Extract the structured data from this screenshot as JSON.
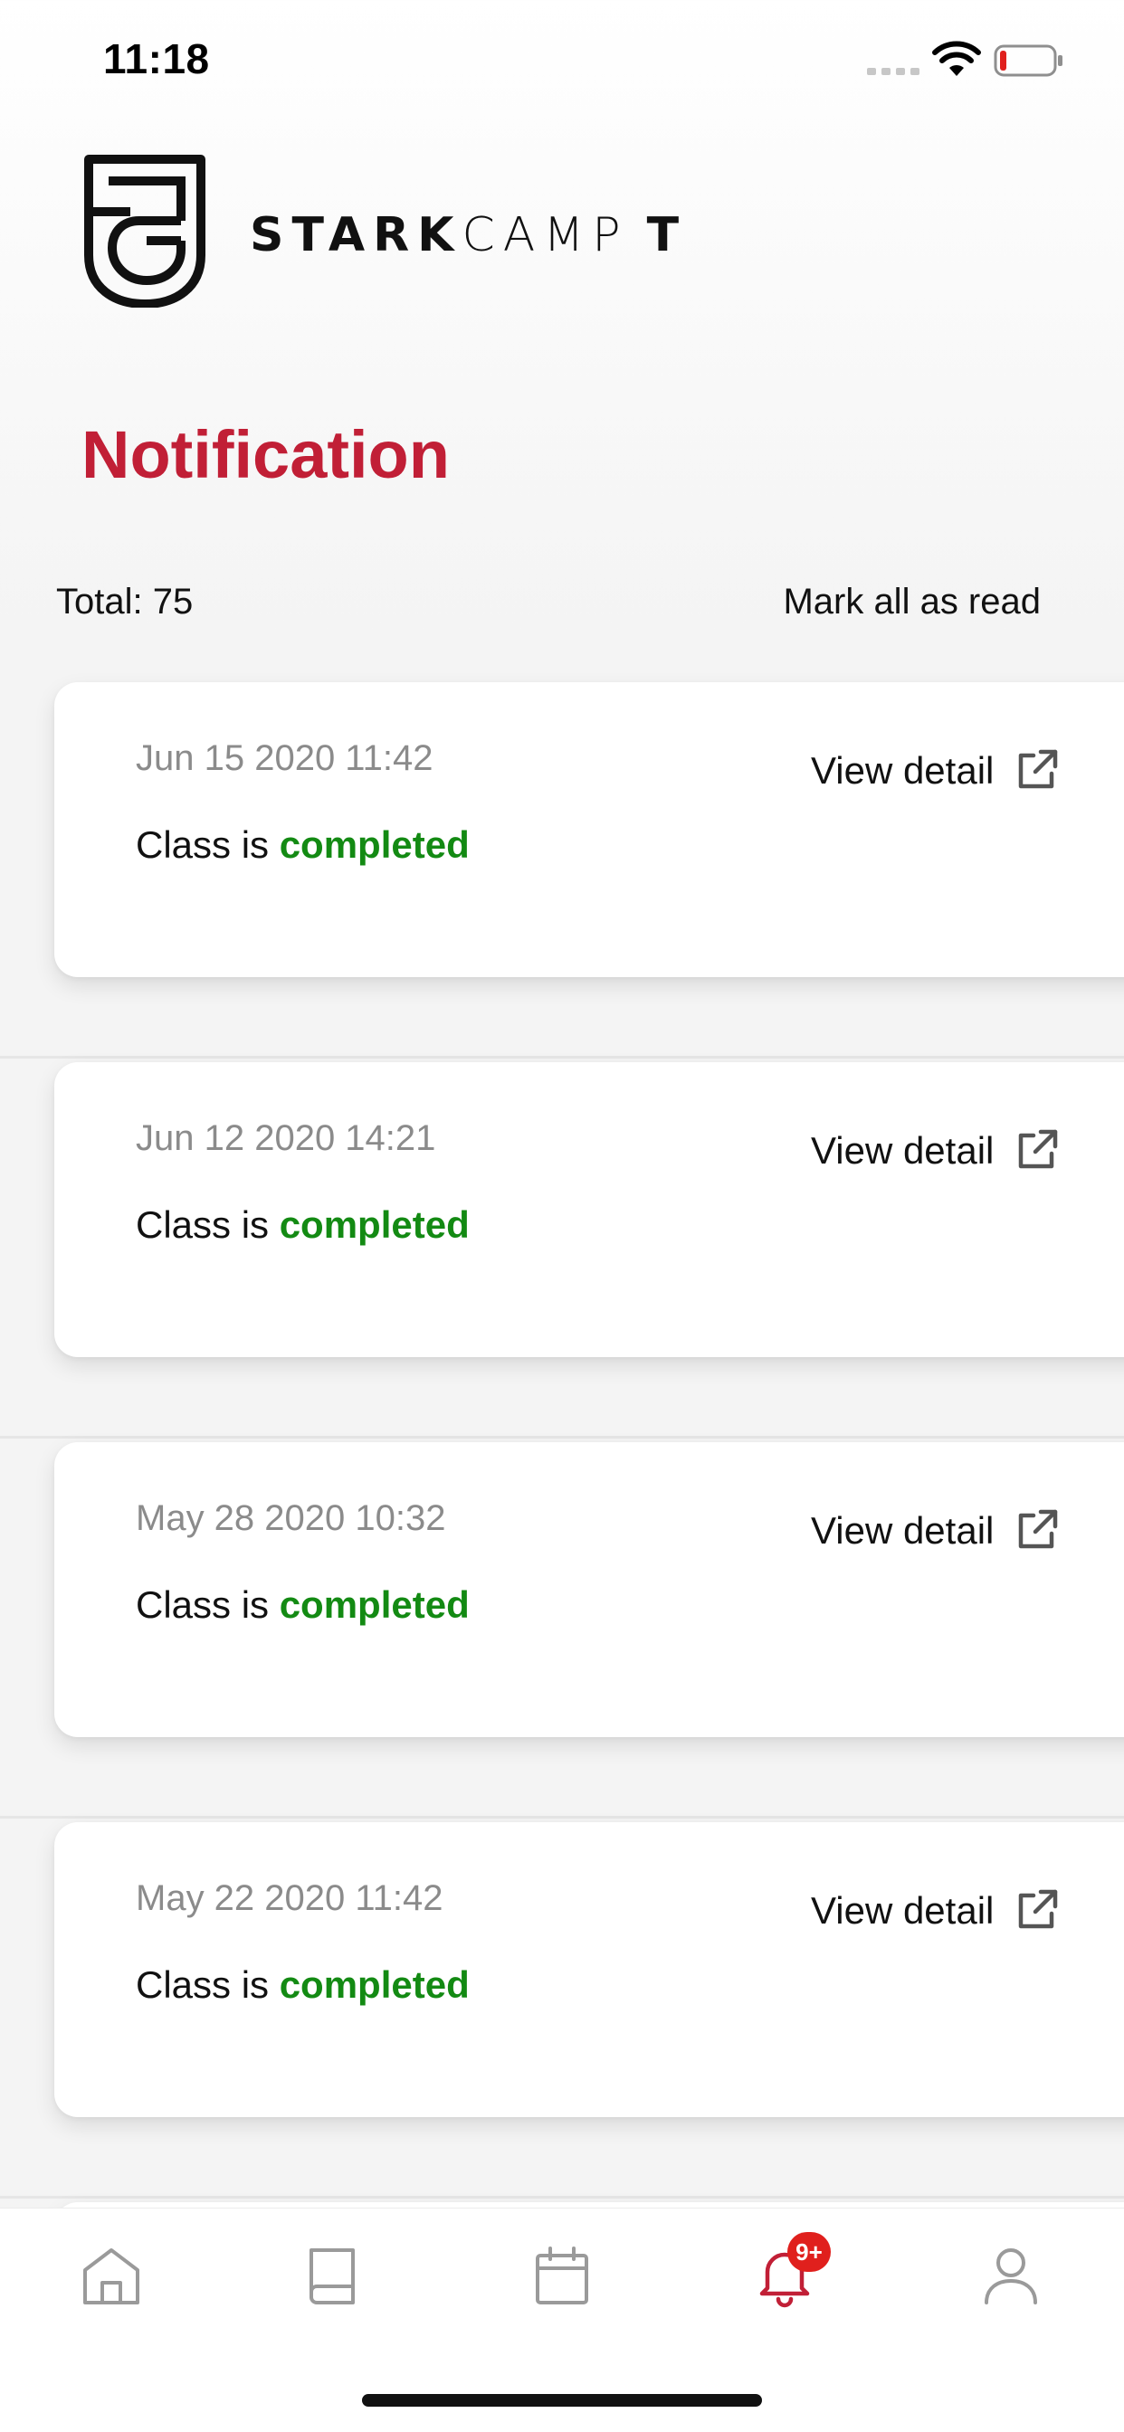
{
  "status_bar": {
    "time": "11:18",
    "icons": [
      "signal-icon",
      "wifi-icon",
      "battery-icon"
    ]
  },
  "brand": {
    "logo_icon": "shield-logo-icon",
    "name_bold": "STARK",
    "name_light": "CAMP",
    "name_suffix": "T"
  },
  "page": {
    "title": "Notification",
    "total_label": "Total: 75",
    "mark_all_label": "Mark all as read"
  },
  "notifications": [
    {
      "date": "Jun 15 2020 11:42",
      "message_prefix": "Class is ",
      "status": "completed",
      "action": "View detail"
    },
    {
      "date": "Jun 12 2020 14:21",
      "message_prefix": "Class is ",
      "status": "completed",
      "action": "View detail"
    },
    {
      "date": "May 28 2020 10:32",
      "message_prefix": "Class is ",
      "status": "completed",
      "action": "View detail"
    },
    {
      "date": "May 22 2020 11:42",
      "message_prefix": "Class is ",
      "status": "completed",
      "action": "View detail"
    }
  ],
  "tab_bar": {
    "tabs": [
      {
        "name": "home",
        "icon": "home-icon",
        "active": false
      },
      {
        "name": "book",
        "icon": "book-icon",
        "active": false
      },
      {
        "name": "calendar",
        "icon": "calendar-icon",
        "active": false
      },
      {
        "name": "notifications",
        "icon": "bell-icon",
        "active": true
      },
      {
        "name": "profile",
        "icon": "user-icon",
        "active": false
      }
    ],
    "notification_badge": "9+"
  },
  "colors": {
    "accent_red": "#c11f36",
    "status_green": "#138a13",
    "badge_red": "#e0201d",
    "inactive_icon": "#9a9a9a"
  }
}
